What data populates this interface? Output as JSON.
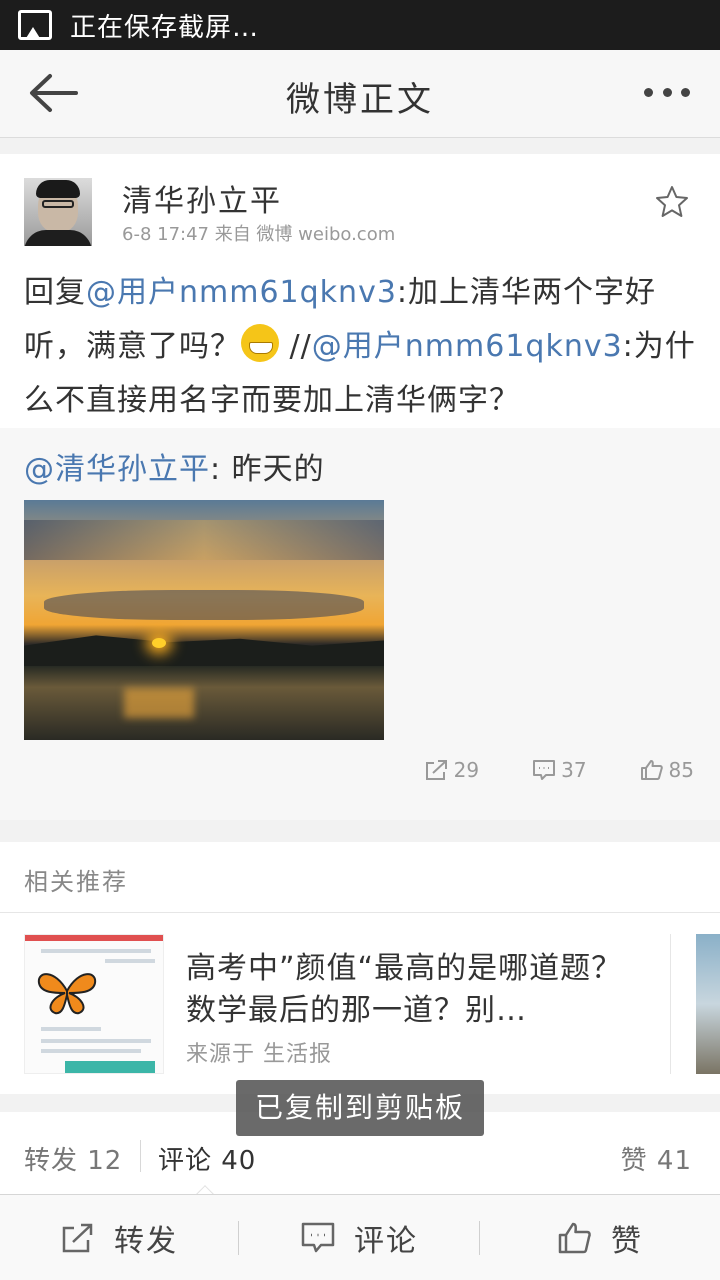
{
  "status_bar": {
    "text": "正在保存截屏…",
    "icon": "image-icon"
  },
  "nav": {
    "title": "微博正文",
    "back_icon": "back-arrow-icon",
    "more_icon": "more-dots-icon"
  },
  "post": {
    "author": "清华孙立平",
    "meta": "6-8 17:47  来自 微博 weibo.com",
    "text": {
      "p1": "回复",
      "m1": "@用户nmm61qknv3",
      "p2": ":加上清华两个字好听，满意了吗？",
      "p3": " //",
      "m2": "@用户nmm61qknv3",
      "p4": ":为什么不直接用名字而要加上清华俩字？"
    },
    "repost": {
      "mention": "@清华孙立平",
      "text": ": 昨天的"
    },
    "stats": {
      "reposts": "29",
      "comments": "37",
      "likes": "85"
    }
  },
  "related": {
    "header": "相关推荐",
    "title": "高考中”颜值“最高的是哪道题？数学最后的那一道？别…",
    "source": "来源于 生活报"
  },
  "toast": "已复制到剪贴板",
  "tabs": {
    "repost": "转发 12",
    "comment": "评论 40",
    "like": "赞 41"
  },
  "toolbar": {
    "repost": "转发",
    "comment": "评论",
    "like": "赞"
  },
  "colors": {
    "mention": "#4a78b0",
    "status_bar": "#1c1c1c"
  }
}
